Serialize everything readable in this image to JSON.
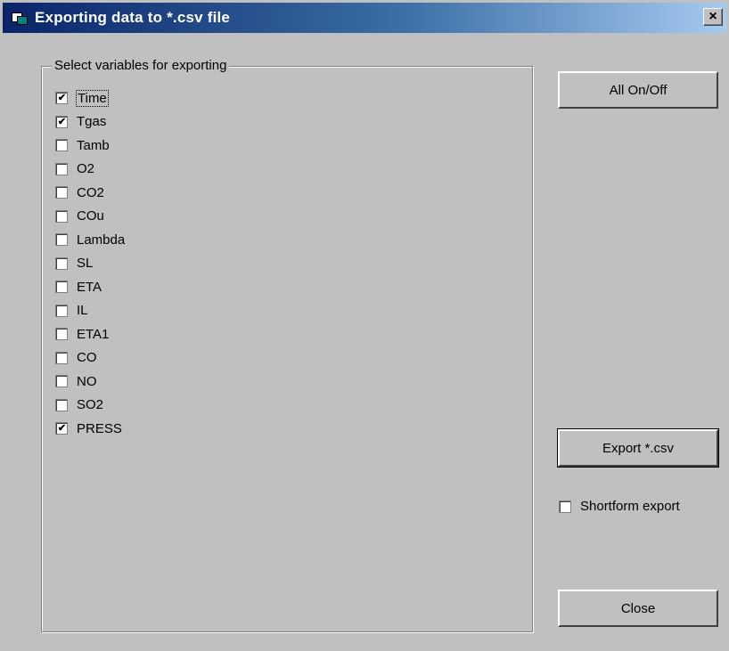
{
  "window": {
    "title": "Exporting data to *.csv file",
    "close_glyph": "×"
  },
  "group": {
    "label": "Select variables for exporting"
  },
  "variables": [
    {
      "label": "Time",
      "checked": true
    },
    {
      "label": "Tgas",
      "checked": true
    },
    {
      "label": "Tamb",
      "checked": false
    },
    {
      "label": "O2",
      "checked": false
    },
    {
      "label": "CO2",
      "checked": false
    },
    {
      "label": "COu",
      "checked": false
    },
    {
      "label": "Lambda",
      "checked": false
    },
    {
      "label": "SL",
      "checked": false
    },
    {
      "label": "ETA",
      "checked": false
    },
    {
      "label": "IL",
      "checked": false
    },
    {
      "label": "ETA1",
      "checked": false
    },
    {
      "label": "CO",
      "checked": false
    },
    {
      "label": "NO",
      "checked": false
    },
    {
      "label": "SO2",
      "checked": false
    },
    {
      "label": "PRESS",
      "checked": true
    }
  ],
  "buttons": {
    "all_on_off": "All On/Off",
    "export_csv": "Export *.csv",
    "close": "Close"
  },
  "shortform": {
    "label": "Shortform export",
    "checked": false
  },
  "icons": {
    "app": "window-app-icon",
    "close": "close-icon",
    "check": "checkmark-icon"
  }
}
